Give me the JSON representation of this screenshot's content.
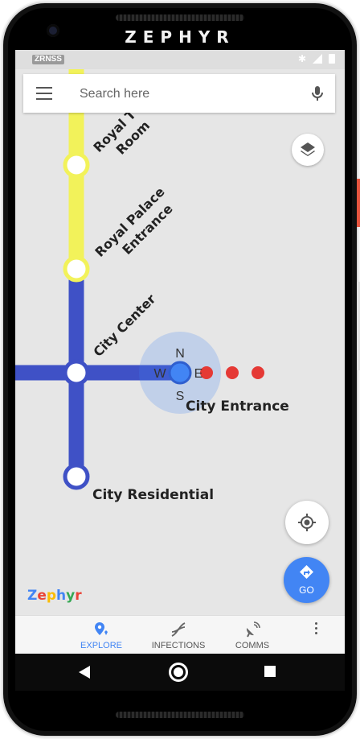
{
  "device": {
    "brand": "ZEPHYR"
  },
  "status_bar": {
    "carrier": "ZRNSS"
  },
  "search": {
    "placeholder": "Search here"
  },
  "map": {
    "stations": {
      "royal_room_line1": "Royal T",
      "royal_room_line2": "Room",
      "royal_palace_line1": "Royal Palace",
      "royal_palace_line2": "Entrance",
      "city_center": "City Center",
      "city_entrance": "City Entrance",
      "city_residential": "City Residential"
    },
    "compass": {
      "n": "N",
      "s": "S",
      "w": "W",
      "e": "E"
    },
    "colors": {
      "yellow_line": "#f2f25a",
      "blue_line": "#3f51c6",
      "route_dots": "#e53935",
      "accent": "#4285f4"
    }
  },
  "fab": {
    "go_label": "GO"
  },
  "logo": {
    "letters": [
      "Z",
      "e",
      "p",
      "h",
      "y",
      "r"
    ],
    "colors": [
      "#4285f4",
      "#ea4335",
      "#fbbc05",
      "#4285f4",
      "#34a853",
      "#ea4335"
    ]
  },
  "bottom_nav": {
    "items": [
      {
        "label": "EXPLORE",
        "icon": "map-pin-icon",
        "active": true
      },
      {
        "label": "INFECTIONS",
        "icon": "dna-icon",
        "active": false
      },
      {
        "label": "COMMS",
        "icon": "satellite-dish-icon",
        "active": false
      }
    ]
  }
}
